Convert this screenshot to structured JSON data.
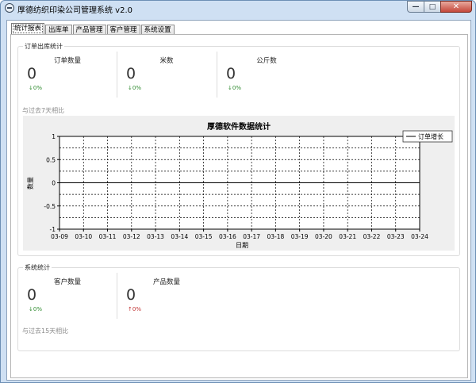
{
  "window": {
    "title": "厚德纺织印染公司管理系统 v2.0",
    "buttons": {
      "minimize": "—",
      "maximize": "□",
      "close": "✕"
    }
  },
  "tabs": [
    {
      "label": "统计报表",
      "active": true
    },
    {
      "label": "出库单",
      "active": false
    },
    {
      "label": "产品管理",
      "active": false
    },
    {
      "label": "客户管理",
      "active": false
    },
    {
      "label": "系统设置",
      "active": false
    }
  ],
  "order_group": {
    "title": "订单出库统计",
    "stats": [
      {
        "label": "订单数量",
        "value": "0",
        "change": "↓0%",
        "direction": "down"
      },
      {
        "label": "米数",
        "value": "0",
        "change": "↓0%",
        "direction": "down"
      },
      {
        "label": "公斤数",
        "value": "0",
        "change": "↓0%",
        "direction": "down"
      }
    ],
    "compare_note": "与过去7天相比"
  },
  "chart_data": {
    "type": "line",
    "title": "厚德软件数据统计",
    "xlabel": "日期",
    "ylabel": "数量",
    "categories": [
      "03-09",
      "03-10",
      "03-11",
      "03-12",
      "03-13",
      "03-14",
      "03-15",
      "03-16",
      "03-17",
      "03-18",
      "03-19",
      "03-20",
      "03-21",
      "03-22",
      "03-23",
      "03-24"
    ],
    "series": [
      {
        "name": "订单增长",
        "values": [
          0,
          0,
          0,
          0,
          0,
          0,
          0,
          0,
          0,
          0,
          0,
          0,
          0,
          0,
          0,
          0
        ],
        "color": "#000000"
      }
    ],
    "yticks": [
      "1",
      "0.5",
      "0",
      "-0.5",
      "-1"
    ],
    "ylim": [
      -1,
      1
    ],
    "grid": true,
    "legend": "top-right",
    "background": "#efefef"
  },
  "system_group": {
    "title": "系统统计",
    "stats": [
      {
        "label": "客户数量",
        "value": "0",
        "change": "↓0%",
        "direction": "down"
      },
      {
        "label": "产品数量",
        "value": "0",
        "change": "↑0%",
        "direction": "up"
      }
    ],
    "compare_note": "与过去15天相比"
  },
  "colors": {
    "titlebar": "#cfe0f3",
    "down": "#2e8b2e",
    "up": "#c03030",
    "muted_text": "#8a8a8a"
  }
}
